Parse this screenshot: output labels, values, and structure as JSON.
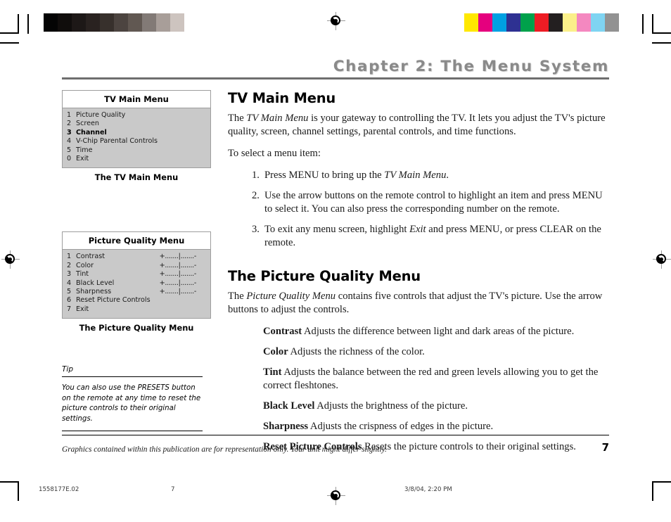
{
  "header": {
    "chapter_title": "Chapter 2: The Menu System"
  },
  "calibration": {
    "gray_swatches": [
      "#040404",
      "#100d0c",
      "#1d1817",
      "#292220",
      "#37302c",
      "#4c4440",
      "#615852",
      "#827a76",
      "#a89e99",
      "#cdc4bf",
      "#ffffff"
    ],
    "color_swatches": [
      "#ffe800",
      "#e5007e",
      "#00a0e2",
      "#2e3192",
      "#00a14b",
      "#ed1c24",
      "#231f20",
      "#fbf08a",
      "#f488c0",
      "#7fd4f2",
      "#929292"
    ]
  },
  "figures": [
    {
      "box_title": "TV Main Menu",
      "caption": "The TV Main Menu",
      "items": [
        {
          "num": "1",
          "label": "Picture Quality",
          "slider": "",
          "highlight": false
        },
        {
          "num": "2",
          "label": "Screen",
          "slider": "",
          "highlight": false
        },
        {
          "num": "3",
          "label": "Channel",
          "slider": "",
          "highlight": true
        },
        {
          "num": "4",
          "label": "V-Chip Parental Controls",
          "slider": "",
          "highlight": false
        },
        {
          "num": "5",
          "label": "Time",
          "slider": "",
          "highlight": false
        },
        {
          "num": "0",
          "label": "Exit",
          "slider": "",
          "highlight": false
        }
      ]
    },
    {
      "box_title": "Picture Quality Menu",
      "caption": "The Picture Quality Menu",
      "items": [
        {
          "num": "1",
          "label": "Contrast",
          "slider": "+.......|.......-",
          "highlight": false
        },
        {
          "num": "2",
          "label": "Color",
          "slider": "+.......|.......-",
          "highlight": false
        },
        {
          "num": "3",
          "label": "Tint",
          "slider": "+.......|.......-",
          "highlight": false
        },
        {
          "num": "4",
          "label": "Black Level",
          "slider": "+.......|.......-",
          "highlight": false
        },
        {
          "num": "5",
          "label": "Sharpness",
          "slider": "+.......|.......-",
          "highlight": false
        },
        {
          "num": "6",
          "label": "Reset Picture Controls",
          "slider": "",
          "highlight": false
        },
        {
          "num": "7",
          "label": "Exit",
          "slider": "",
          "highlight": false
        }
      ]
    }
  ],
  "tip": {
    "label": "Tip",
    "body": "You can also use the PRESETS button on the remote at any time to reset the picture controls to their original settings."
  },
  "main": {
    "section1": {
      "heading": "TV Main Menu",
      "intro_lead": "The ",
      "intro_em": "TV Main Menu",
      "intro_rest": " is your gateway to controlling the TV.  It lets you adjust the TV's picture quality, screen, channel settings, parental controls, and time functions.",
      "select_line": "To select a menu item:",
      "steps": [
        {
          "lead": "Press MENU to bring up the ",
          "em": "TV Main Menu",
          "rest": "."
        },
        {
          "lead": "Use the arrow buttons on the remote control to highlight an item and press MENU to select it. You can also press the corresponding number on the remote.",
          "em": "",
          "rest": ""
        },
        {
          "lead": "To exit any menu screen, highlight ",
          "em": "Exit",
          "rest": " and press MENU, or press CLEAR on the remote."
        }
      ]
    },
    "section2": {
      "heading": "The Picture Quality Menu",
      "intro_lead": "The ",
      "intro_em": "Picture Quality Menu",
      "intro_rest": " contains five controls that adjust the TV's picture. Use the arrow buttons to adjust the controls.",
      "definitions": [
        {
          "term": "Contrast",
          "text": "  Adjusts the difference between light and dark areas of the picture."
        },
        {
          "term": "Color",
          "text": "  Adjusts the richness of the color."
        },
        {
          "term": "Tint",
          "text": "  Adjusts the balance between the red and green levels allowing you to get the correct fleshtones."
        },
        {
          "term": "Black Level",
          "text": "  Adjusts the brightness of the picture."
        },
        {
          "term": "Sharpness",
          "text": "  Adjusts the crispness of edges in the picture."
        },
        {
          "term": "Reset Picture Controls",
          "text": "  Resets the picture controls to their original settings."
        }
      ]
    }
  },
  "footer": {
    "disclaimer": "Graphics contained within this publication are for representation only. Your unit might differ slightly.",
    "page_number": "7"
  },
  "print_meta": {
    "doc_code": "1558177E.02",
    "page": "7",
    "date": "3/8/04, 2:20 PM"
  }
}
